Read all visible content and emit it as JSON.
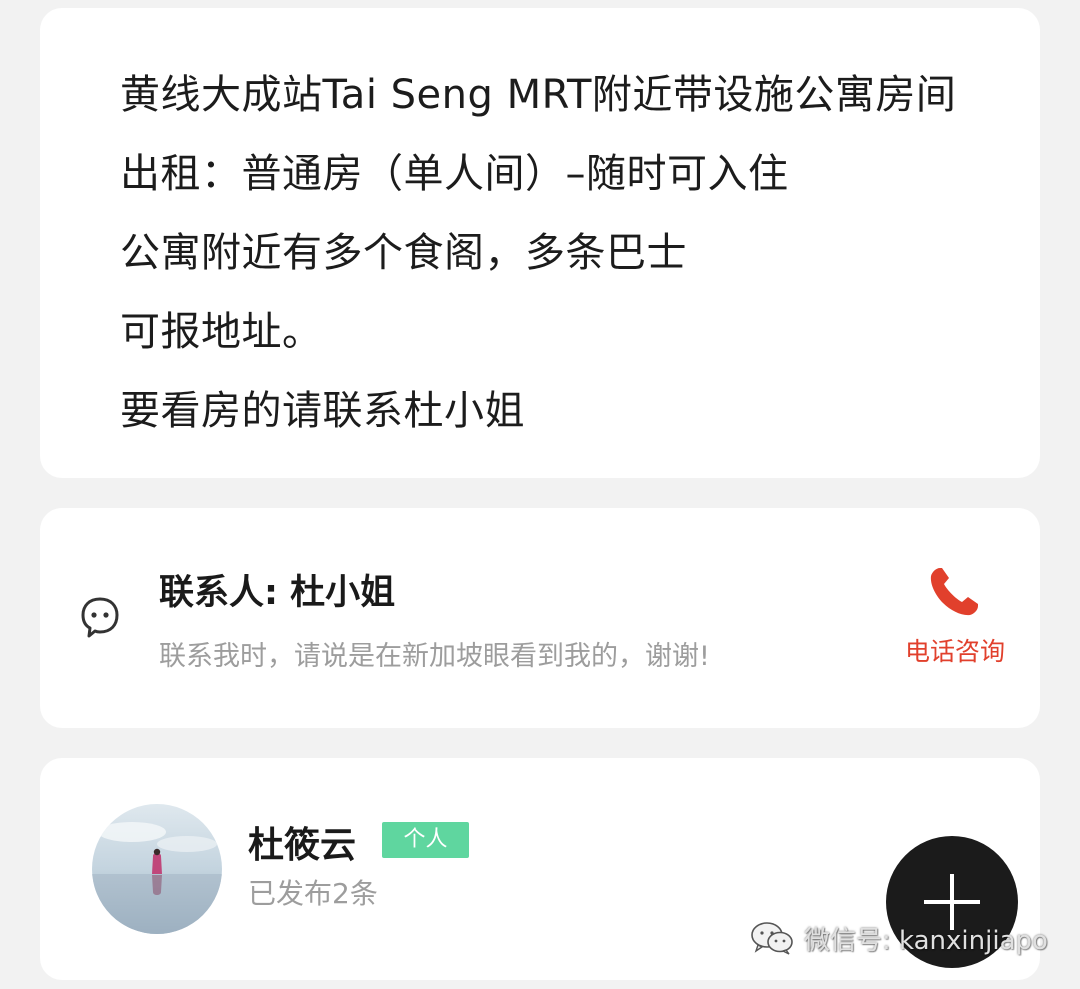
{
  "description": {
    "lines": [
      "黄线大成站Tai Seng MRT附近带设施公寓房间",
      "出租：普通房（单人间）–随时可入住",
      "公寓附近有多个食阁，多条巴士",
      "可报地址。",
      "要看房的请联系杜小姐"
    ]
  },
  "contact": {
    "icon": "chat-bubble-face-icon",
    "name": "联系人: 杜小姐",
    "note": "联系我时，请说是在新加坡眼看到我的，谢谢!",
    "phone_icon": "phone-handset-icon",
    "phone_label": "电话咨询"
  },
  "publisher": {
    "name": "杜筱云",
    "type_badge": "个人",
    "post_count": "已发布2条"
  },
  "fab": {
    "icon": "plus-icon"
  },
  "watermark": {
    "icon": "wechat-icon",
    "text": "微信号: kanxinjiapo"
  },
  "colors": {
    "background": "#f2f2f2",
    "card": "#ffffff",
    "badge_green": "#5fd69f",
    "phone_red": "#e1402c",
    "muted_text": "#9d9d9d",
    "fab": "#1b1b1b"
  }
}
